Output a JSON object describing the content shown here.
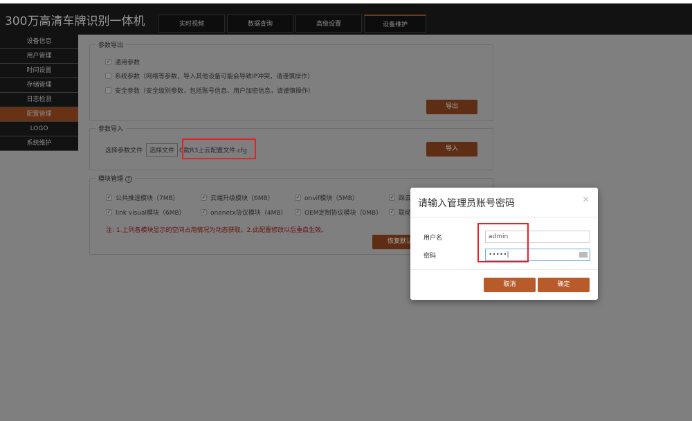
{
  "header": {
    "title": "300万高清车牌识别一体机",
    "tabs": [
      {
        "label": "实时视频"
      },
      {
        "label": "数据查询"
      },
      {
        "label": "高级设置"
      },
      {
        "label": "设备维护",
        "active": true
      }
    ]
  },
  "sidebar": {
    "items": [
      {
        "label": "设备信息"
      },
      {
        "label": "用户管理"
      },
      {
        "label": "时间设置"
      },
      {
        "label": "存储管理"
      },
      {
        "label": "日志检测"
      },
      {
        "label": "配置管理",
        "active": true
      },
      {
        "label": "LOGO"
      },
      {
        "label": "系统维护"
      }
    ]
  },
  "export": {
    "legend": "参数导出",
    "options": [
      {
        "label": "通用参数",
        "checked": true
      },
      {
        "label": "系统参数（网络等参数，导入其他设备可能会导致IP冲突，请谨慎操作）",
        "checked": false
      },
      {
        "label": "安全参数（安全级别参数，包括账号信息、用户加密信息，请谨慎操作）",
        "checked": false
      }
    ],
    "button": "导出"
  },
  "import": {
    "legend": "参数导入",
    "label": "选择参数文件",
    "file_button": "选择文件",
    "file_name": "C款R3上云配置文件.cfg",
    "button": "导入"
  },
  "modules": {
    "legend": "模块管理",
    "help": "?",
    "items": [
      {
        "label": "公共推送模块（7MB）",
        "checked": true
      },
      {
        "label": "云端升级模块（6MB）",
        "checked": true
      },
      {
        "label": "onvif模块（5MB）",
        "checked": true
      },
      {
        "label": "踩云",
        "checked": true
      },
      {
        "label": "link visual模块（6MB）",
        "checked": true
      },
      {
        "label": "onenetx协议模块（4MB）",
        "checked": true
      },
      {
        "label": "OEM定制协议模块（0MB）",
        "checked": true
      },
      {
        "label": "联动",
        "checked": true
      }
    ],
    "note": "注: 1.上列各模块显示的空间占用情况为动态获取。2.此配置修改以后重启生效。",
    "restore_button": "恢复默认"
  },
  "dialog": {
    "title": "请输入管理员账号密码",
    "close": "×",
    "username_label": "用户名",
    "username_value": "admin",
    "password_label": "密码",
    "password_value": "•••••",
    "cancel": "取消",
    "confirm": "确定"
  },
  "colors": {
    "accent": "#b85a2a",
    "highlight": "#e82020"
  }
}
